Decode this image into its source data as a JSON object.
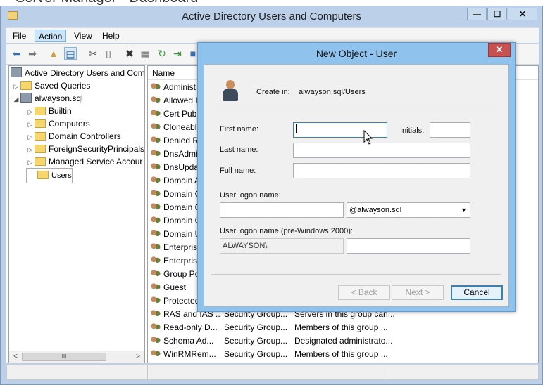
{
  "background_window_title": "Server Manager • Dashboard",
  "window": {
    "title": "Active Directory Users and Computers",
    "buttons": {
      "minimize": "—",
      "maximize": "☐",
      "close": "✕"
    }
  },
  "menu": [
    "File",
    "Action",
    "View",
    "Help"
  ],
  "toolbar_icons": [
    "back-icon",
    "forward-icon",
    "up-folder-icon",
    "show-console-tree-icon",
    "cut-icon",
    "copy-icon",
    "delete-icon",
    "properties-icon",
    "refresh-icon",
    "export-list-icon",
    "help-icon"
  ],
  "tree": {
    "root": "Active Directory Users and Com",
    "items": [
      {
        "label": "Saved Queries",
        "level": 1,
        "expander": "▷"
      },
      {
        "label": "alwayson.sql",
        "level": 1,
        "expander": "◢"
      },
      {
        "label": "Builtin",
        "level": 2,
        "expander": "▷"
      },
      {
        "label": "Computers",
        "level": 2,
        "expander": "▷"
      },
      {
        "label": "Domain Controllers",
        "level": 2,
        "expander": "▷"
      },
      {
        "label": "ForeignSecurityPrincipals",
        "level": 2,
        "expander": "▷"
      },
      {
        "label": "Managed Service Accour",
        "level": 2,
        "expander": "▷"
      },
      {
        "label": "Users",
        "level": 2,
        "expander": ""
      }
    ],
    "scroll_thumb": "III",
    "scroll_left": "<",
    "scroll_right": ">"
  },
  "list": {
    "header": {
      "name": "Name"
    },
    "rows": [
      {
        "name": "Administ",
        "type": "",
        "desc": ""
      },
      {
        "name": "Allowed I",
        "type": "",
        "desc": ""
      },
      {
        "name": "Cert Publ",
        "type": "",
        "desc": ""
      },
      {
        "name": "Cloneabl",
        "type": "",
        "desc": ""
      },
      {
        "name": "Denied R",
        "type": "",
        "desc": ""
      },
      {
        "name": "DnsAdmi",
        "type": "",
        "desc": ""
      },
      {
        "name": "DnsUpda",
        "type": "",
        "desc": ""
      },
      {
        "name": "Domain A",
        "type": "",
        "desc": ""
      },
      {
        "name": "Domain C",
        "type": "",
        "desc": ""
      },
      {
        "name": "Domain C",
        "type": "",
        "desc": ""
      },
      {
        "name": "Domain C",
        "type": "",
        "desc": ""
      },
      {
        "name": "Domain U",
        "type": "",
        "desc": ""
      },
      {
        "name": "Enterprise",
        "type": "",
        "desc": ""
      },
      {
        "name": "Enterprise",
        "type": "",
        "desc": ""
      },
      {
        "name": "Group Po",
        "type": "",
        "desc": ""
      },
      {
        "name": "Guest",
        "type": "",
        "desc": ""
      },
      {
        "name": "Protected",
        "type": "",
        "desc": ""
      },
      {
        "name": "RAS and IAS ...",
        "type": "Security Group...",
        "desc": "Servers in this group can..."
      },
      {
        "name": "Read-only D...",
        "type": "Security Group...",
        "desc": "Members of this group ..."
      },
      {
        "name": "Schema Ad...",
        "type": "Security Group...",
        "desc": "Designated administrato..."
      },
      {
        "name": "WinRMRem...",
        "type": "Security Group...",
        "desc": "Members of this group ..."
      }
    ]
  },
  "dialog": {
    "title": "New Object - User",
    "close": "✕",
    "create_in_label": "Create in:",
    "create_in_value": "alwayson.sql/Users",
    "first_name_label": "First name:",
    "first_name_value": "",
    "initials_label": "Initials:",
    "initials_value": "",
    "last_name_label": "Last name:",
    "last_name_value": "",
    "full_name_label": "Full name:",
    "full_name_value": "",
    "logon_label": "User logon name:",
    "logon_value": "",
    "domain_suffix": "@alwayson.sql",
    "pre2000_label": "User logon name (pre-Windows 2000):",
    "pre2000_domain": "ALWAYSON\\",
    "pre2000_value": "",
    "back_button": "< Back",
    "next_button": "Next >",
    "cancel_button": "Cancel"
  }
}
